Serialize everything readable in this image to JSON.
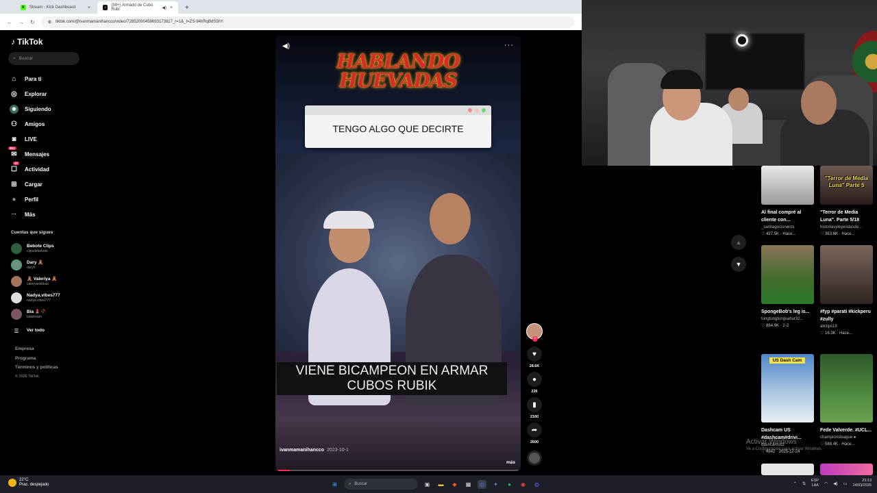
{
  "browser": {
    "tabs": [
      {
        "title": "Stream - Kick Dashboard",
        "icon": "K",
        "color": "#53fc18"
      },
      {
        "title": "(99+) Armado de Cubo Rubi",
        "icon": "♪",
        "color": "#111111"
      }
    ],
    "url": "tiktok.com/@ivanmamanihancco/video/72852090458693173817_r=1&_t=ZS-94hRqBdS5hY"
  },
  "tiktok": {
    "brand": "TikTok",
    "search_placeholder": "Buscar",
    "nav": [
      {
        "label": "Para ti",
        "icon": "⌂"
      },
      {
        "label": "Explorar",
        "icon": "◎"
      },
      {
        "label": "Siguiendo",
        "icon": "◉"
      },
      {
        "label": "Amigos",
        "icon": "⚇"
      },
      {
        "label": "LIVE",
        "icon": "◙"
      },
      {
        "label": "Mensajes",
        "icon": "✉",
        "badge": "99+"
      },
      {
        "label": "Actividad",
        "icon": "☐",
        "badge": "47"
      },
      {
        "label": "Cargar",
        "icon": "⊞"
      },
      {
        "label": "Perfil",
        "icon": "●"
      },
      {
        "label": "Más",
        "icon": "···"
      }
    ],
    "following_title": "Cuentas que sigues",
    "following": [
      {
        "name": "Bebote Clips",
        "handle": "clipsdebebote",
        "color": "#2f5e3c"
      },
      {
        "name": "Dary 🧸",
        "handle": "daryh",
        "color": "#6b8f7a"
      },
      {
        "name": "🧸 Valeriya 🧸",
        "handle": "valeryankkkaa",
        "color": "#a4735c"
      },
      {
        "name": "Nadya.vibes777",
        "handle": "nadya.vibes777",
        "color": "#dddddd"
      },
      {
        "name": "Bia 💄🥀",
        "handle": "biastream",
        "color": "#7a5560"
      }
    ],
    "see_all": "Ver todo",
    "footer": [
      "Empresa",
      "Programa",
      "Términos y políticas"
    ],
    "copyright": "© 2026 TikTok"
  },
  "video": {
    "overlay_title": "HABLANDO HUEVADAS",
    "dialog_text": "TENGO ALGO QUE DECIRTE",
    "subtitle": "VIENE BICAMPEON EN ARMAR CUBOS RUBIK",
    "author": "ivanmamanihancco",
    "date": "2023-10-1",
    "more_label": "más",
    "progress": 0.06,
    "likes": "28.6K",
    "comments": "226",
    "saves": "2160",
    "shares": "2600"
  },
  "recommended": [
    {
      "title": "Al final compré al cliente con...",
      "user": "_santiagocisneros",
      "stats": "♡ 427.5K · Hace...",
      "color": "#cfcfcf",
      "label": ""
    },
    {
      "title": "\"Terror de Media Luna\". Parte 5/18",
      "user": "historiasyleyendasde...",
      "stats": "♡ 363.6K · Hace...",
      "color": "#3a2a2a",
      "label": "\"Terror de Media Luna\" Parte 5"
    },
    {
      "title": "SpongeBob's leg is...",
      "user": "tungtungtungsahur32...",
      "stats": "♡ 864.9K · 2-2",
      "color": "#7a6a4a",
      "label": ""
    },
    {
      "title": "#fyp #parati #kickperu #zully",
      "user": "aliclips19",
      "stats": "♡ 16.3K · Hace...",
      "color": "#4a3c38",
      "label": ""
    },
    {
      "title": "Dashcam US #dashcam#drivi...",
      "user": "dashcamus2",
      "stats": "♡ 4942 · 2025-12-24",
      "color": "#4f7fb7",
      "label": "US Dash Cam"
    },
    {
      "title": "Fede Valverde. #UCL...",
      "user": "championsleague ●",
      "stats": "♡ 588.4K · Hace...",
      "color": "#3d6a3a",
      "label": ""
    }
  ],
  "watermark": {
    "title": "Activar Windows",
    "subtitle": "Ve a Configuración para activar Windows."
  },
  "taskbar": {
    "temp": "22°C",
    "weather": "Prac. despejado",
    "search": "Buscar",
    "lang": "ESP",
    "lang2": "LAA",
    "time": "23:13",
    "date": "14/03/2026"
  }
}
